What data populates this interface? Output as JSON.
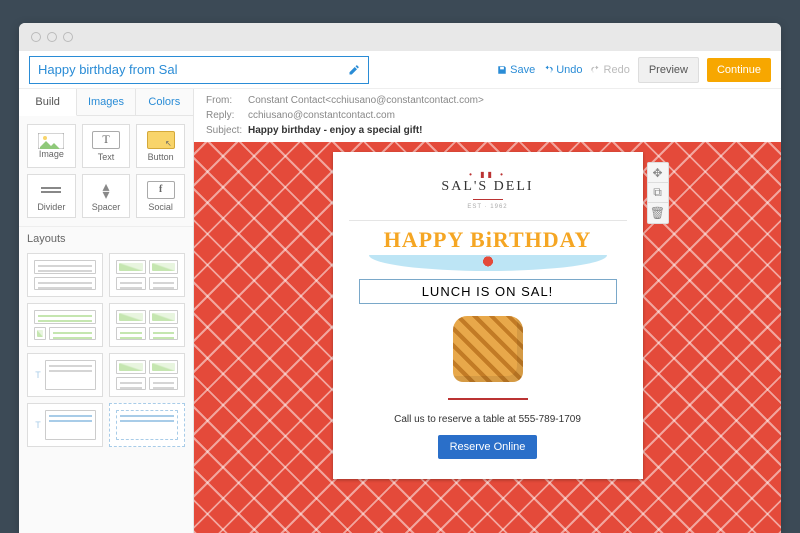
{
  "campaign_title": "Happy birthday from Sal",
  "actions": {
    "save": "Save",
    "undo": "Undo",
    "redo": "Redo",
    "preview": "Preview",
    "continue": "Continue"
  },
  "sidebar": {
    "tabs": [
      "Build",
      "Images",
      "Colors"
    ],
    "blocks": [
      {
        "label": "Image"
      },
      {
        "label": "Text"
      },
      {
        "label": "Button"
      },
      {
        "label": "Divider"
      },
      {
        "label": "Spacer"
      },
      {
        "label": "Social"
      }
    ],
    "layouts_label": "Layouts"
  },
  "meta": {
    "from_label": "From:",
    "from_value": "Constant Contact<cchiusano@constantcontact.com>",
    "reply_label": "Reply:",
    "reply_value": "cchiusano@constantcontact.com",
    "subject_label": "Subject:",
    "subject_value": "Happy birthday - enjoy a special gift!"
  },
  "email": {
    "brand": "SAL'S DELI",
    "est": "EST · 1962",
    "headline": "HAPPY BiRTHDAY",
    "subhead": "LUNCH IS ON SAL!",
    "call_text": "Call us to reserve a table at 555-789-1709",
    "cta": "Reserve Online"
  }
}
